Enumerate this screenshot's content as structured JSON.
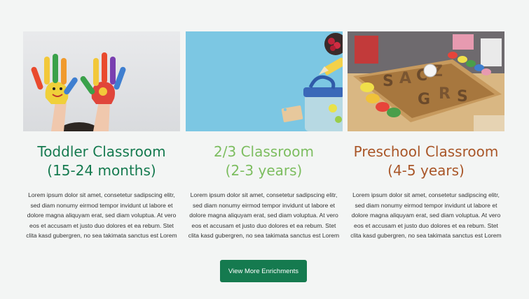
{
  "colors": {
    "page_background": "#f3f5f4",
    "toddler_title": "#157a4f",
    "twothree_title": "#7cbd5f",
    "preschool_title": "#a95628",
    "button_background": "#157a4f",
    "button_text": "#ffffff"
  },
  "cards": [
    {
      "title_line1": "Toddler Classroom",
      "title_line2": "(15-24 months)",
      "body": "Lorem ipsum dolor sit amet, consetetur sadipscing elitr, sed diam nonumy eirmod tempor invidunt ut labore et dolore magna aliquyam erat, sed diam voluptua. At vero eos et accusam et justo duo dolores et ea rebum. Stet clita kasd gubergren, no sea takimata sanctus est Lorem",
      "image_icon": "painted-hands-photo-icon"
    },
    {
      "title_line1": "2/3 Classroom",
      "title_line2": "(2-3 years)",
      "body": "Lorem ipsum dolor sit amet, consetetur sadipscing elitr, sed diam nonumy eirmod tempor invidunt ut labore et dolore magna aliquyam erat, sed diam voluptua. At vero eos et accusam et justo duo dolores et ea rebum. Stet clita kasd gubergren, no sea takimata sanctus est Lorem",
      "image_icon": "lunchbox-photo-icon"
    },
    {
      "title_line1": "Preschool Classroom",
      "title_line2": "(4-5 years)",
      "body": "Lorem ipsum dolor sit amet, consetetur sadipscing elitr, sed diam nonumy eirmod tempor invidunt ut labore et dolore magna aliquyam erat, sed diam voluptua. At vero eos et accusam et justo duo dolores et ea rebum. Stet clita kasd gubergren, no sea takimata sanctus est Lorem",
      "image_icon": "wooden-letters-playdough-photo-icon"
    }
  ],
  "button": {
    "label": "View More Enrichments"
  }
}
